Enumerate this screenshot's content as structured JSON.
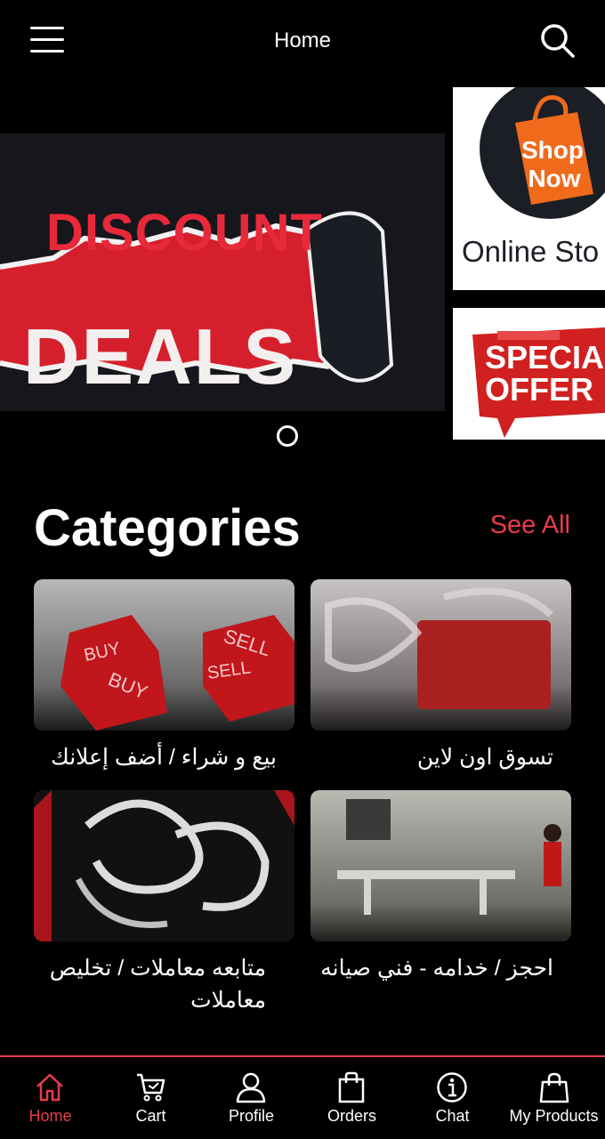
{
  "header": {
    "title": "Home",
    "menu_icon": "hamburger-menu-icon",
    "search_icon": "search-icon"
  },
  "banner": {
    "slide_main": {
      "line1": "DISCOUNT",
      "line2": "DEALS"
    },
    "slide_side_top": {
      "shop": "Shop",
      "now": "Now",
      "caption": "Online Sto"
    },
    "slide_side_bottom": {
      "line1": "SPECIAL",
      "line2": "OFFER"
    },
    "indicator_count": 1
  },
  "categories": {
    "heading": "Categories",
    "see_all": "See All",
    "items": [
      {
        "label": "بيع و شراء / أضف إعلانك",
        "thumb_text_1": "BUY",
        "thumb_text_2": "SELL"
      },
      {
        "label": "تسوق اون لاين"
      },
      {
        "label": "متابعه معاملات  / تخليص معاملات"
      },
      {
        "label": "احجز / خدامه - فني صيانه"
      }
    ]
  },
  "bottom_nav": {
    "items": [
      {
        "label": "Home",
        "icon": "home-icon",
        "active": true
      },
      {
        "label": "Cart",
        "icon": "cart-icon",
        "active": false
      },
      {
        "label": "Profile",
        "icon": "profile-icon",
        "active": false
      },
      {
        "label": "Orders",
        "icon": "shopping-bag-icon",
        "active": false
      },
      {
        "label": "Chat",
        "icon": "info-icon",
        "active": false
      },
      {
        "label": "My Products",
        "icon": "shopping-bag-outline-icon",
        "active": false
      }
    ]
  },
  "colors": {
    "background": "#000000",
    "accent": "#e83b4e",
    "text": "#ffffff"
  }
}
